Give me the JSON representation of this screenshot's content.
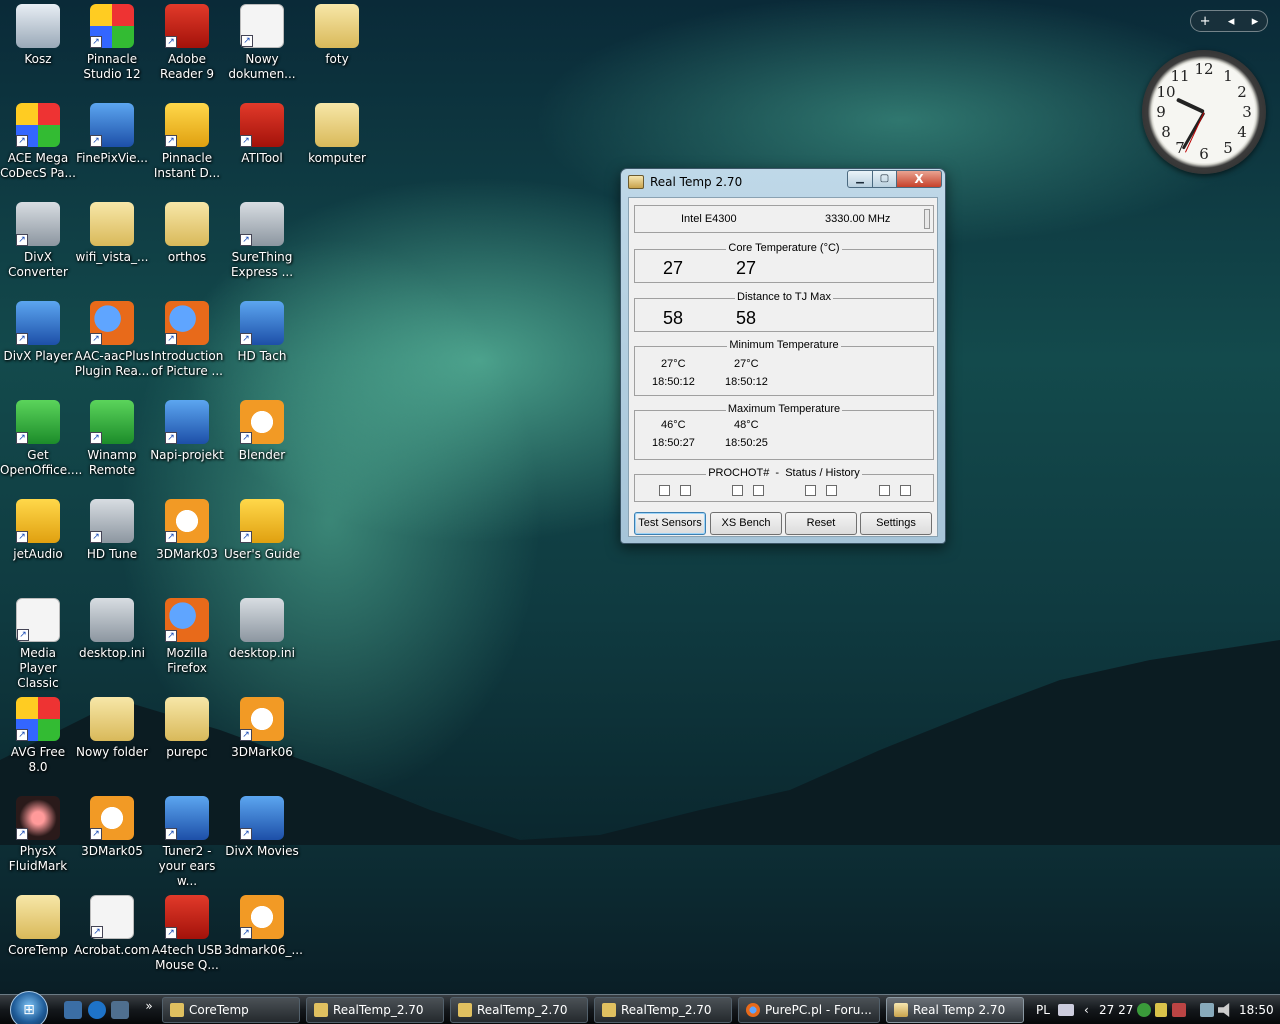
{
  "desktop": {
    "icons": [
      {
        "label": "Kosz",
        "glyph": "recycle-bin-icon"
      },
      {
        "label": "Pinnacle Studio 12",
        "glyph": "pinnacle-studio-icon"
      },
      {
        "label": "Adobe Reader 9",
        "glyph": "adobe-reader-icon"
      },
      {
        "label": "Nowy dokumen...",
        "glyph": "text-document-icon"
      },
      {
        "label": "foty",
        "glyph": "folder-icon"
      },
      {
        "label": "ACE Mega CoDecS Pa...",
        "glyph": "ace-codecs-icon"
      },
      {
        "label": "FinePixVie...",
        "glyph": "finepix-viewer-icon"
      },
      {
        "label": "Pinnacle Instant D...",
        "glyph": "pinnacle-instant-icon"
      },
      {
        "label": "ATITool",
        "glyph": "atitool-icon"
      },
      {
        "label": "komputer",
        "glyph": "folder-icon"
      },
      {
        "label": "DivX Converter",
        "glyph": "divx-converter-icon"
      },
      {
        "label": "wifi_vista_...",
        "glyph": "folder-icon"
      },
      {
        "label": "orthos",
        "glyph": "folder-icon"
      },
      {
        "label": "SureThing Express ...",
        "glyph": "surething-icon"
      },
      {
        "label": "DivX Player",
        "glyph": "divx-player-icon"
      },
      {
        "label": "AAC-aacPlus Plugin Rea...",
        "glyph": "firefox-document-icon"
      },
      {
        "label": "Introduction of Picture ...",
        "glyph": "firefox-document-icon"
      },
      {
        "label": "HD Tach",
        "glyph": "hd-tach-icon"
      },
      {
        "label": "Get OpenOffice....",
        "glyph": "openoffice-icon"
      },
      {
        "label": "Winamp Remote",
        "glyph": "winamp-icon"
      },
      {
        "label": "Napi-projekt",
        "glyph": "napi-projekt-icon"
      },
      {
        "label": "Blender",
        "glyph": "blender-icon"
      },
      {
        "label": "jetAudio",
        "glyph": "jetaudio-icon"
      },
      {
        "label": "HD Tune",
        "glyph": "hd-tune-icon"
      },
      {
        "label": "3DMark03",
        "glyph": "3dmark-icon"
      },
      {
        "label": "User's Guide",
        "glyph": "help-guide-icon"
      },
      {
        "label": "Media Player Classic",
        "glyph": "media-player-classic-icon"
      },
      {
        "label": "desktop.ini",
        "glyph": "settings-file-icon"
      },
      {
        "label": "Mozilla Firefox",
        "glyph": "firefox-icon"
      },
      {
        "label": "desktop.ini",
        "glyph": "settings-file-icon"
      },
      {
        "label": "AVG Free 8.0",
        "glyph": "avg-icon"
      },
      {
        "label": "Nowy folder",
        "glyph": "folder-icon"
      },
      {
        "label": "purepc",
        "glyph": "folder-icon"
      },
      {
        "label": "3DMark06",
        "glyph": "3dmark-icon"
      },
      {
        "label": "PhysX FluidMark",
        "glyph": "physx-icon"
      },
      {
        "label": "3DMark05",
        "glyph": "3dmark-icon"
      },
      {
        "label": "Tuner2 - your ears w...",
        "glyph": "tuner-icon"
      },
      {
        "label": "DivX Movies",
        "glyph": "divx-movies-icon"
      },
      {
        "label": "CoreTemp",
        "glyph": "folder-icon"
      },
      {
        "label": "Acrobat.com",
        "glyph": "acrobat-icon"
      },
      {
        "label": "A4tech USB Mouse Q...",
        "glyph": "a4tech-icon"
      },
      {
        "label": "3dmark06_...",
        "glyph": "3dmark-icon"
      }
    ]
  },
  "gadgets": {
    "bar": {
      "add": "+",
      "prev": "◂",
      "next": "▸"
    },
    "clock": {
      "numbers": [
        "12",
        "1",
        "2",
        "3",
        "4",
        "5",
        "6",
        "7",
        "8",
        "9",
        "10",
        "11"
      ],
      "time": "18:50"
    }
  },
  "window": {
    "title": "Real Temp 2.70",
    "controls": {
      "minimize": "▁",
      "maximize": "▢",
      "close": "X"
    },
    "cpu": {
      "model": "Intel E4300",
      "freq": "3330.00 MHz"
    },
    "core_temp": {
      "label": "Core Temperature (°C)",
      "values": [
        "27",
        "27"
      ]
    },
    "distance": {
      "label": "Distance to TJ Max",
      "values": [
        "58",
        "58"
      ]
    },
    "min_temp": {
      "label": "Minimum Temperature",
      "values": [
        "27°C",
        "27°C"
      ],
      "times": [
        "18:50:12",
        "18:50:12"
      ]
    },
    "max_temp": {
      "label": "Maximum Temperature",
      "values": [
        "46°C",
        "48°C"
      ],
      "times": [
        "18:50:27",
        "18:50:25"
      ]
    },
    "prochot": {
      "label": "PROCHOT#  -  Status / History"
    },
    "buttons": {
      "test": "Test Sensors",
      "xs": "XS Bench",
      "reset": "Reset",
      "settings": "Settings"
    }
  },
  "taskbar": {
    "start": "⊞",
    "tasks": [
      {
        "label": "CoreTemp",
        "icon": "folder-icon"
      },
      {
        "label": "RealTemp_2.70",
        "icon": "folder-icon"
      },
      {
        "label": "RealTemp_2.70",
        "icon": "folder-icon"
      },
      {
        "label": "RealTemp_2.70",
        "icon": "folder-icon"
      },
      {
        "label": "PurePC.pl - Foru...",
        "icon": "firefox-icon"
      },
      {
        "label": "Real Temp 2.70",
        "icon": "realtemp-icon"
      }
    ],
    "overflow": "»",
    "tray": {
      "lang": "PL",
      "temps": "27 27",
      "time": "18:50",
      "chevron": "‹"
    }
  },
  "colors": {
    "accent": "#1f5c99",
    "close": "#c6412a"
  }
}
